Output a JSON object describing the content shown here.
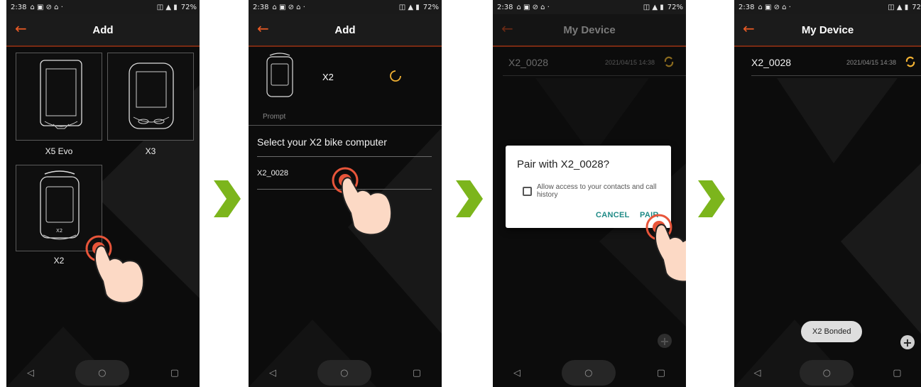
{
  "colors": {
    "accent": "#ea5b25",
    "arrow_green": "#7cb51c",
    "dialog_button": "#1e8a86",
    "spinner": "#f2b233"
  },
  "status_bar": {
    "time": "2:38",
    "battery": "72%",
    "battery_cut": "72"
  },
  "icons": {
    "back": "arrow-left-icon",
    "nav_back": "nav-back-icon",
    "nav_home": "nav-home-icon",
    "nav_recent": "nav-recent-icon",
    "arrow_right": "chevron-right-icon",
    "sync": "sync-icon",
    "add": "plus-icon",
    "hand": "tap-hand-icon",
    "spinner": "loading-spinner-icon"
  },
  "nav_glyphs": {
    "back": "◁",
    "home": "○",
    "recent": "▢"
  },
  "back_glyph": "←",
  "fab_glyph": "+",
  "screen1": {
    "title": "Add",
    "devices": [
      {
        "label": "X5 Evo"
      },
      {
        "label": "X3"
      },
      {
        "label": "X2"
      }
    ]
  },
  "screen2": {
    "title": "Add",
    "device_name": "X2",
    "prompt_label": "Prompt",
    "instruction": "Select your X2 bike computer",
    "list_item": "X2_0028"
  },
  "screen3": {
    "title": "My Device",
    "device_row": {
      "name": "X2_0028",
      "timestamp": "2021/04/15 14:38"
    },
    "dialog": {
      "title": "Pair with X2_0028?",
      "checkbox_label": "Allow access to your contacts and call history",
      "cancel": "CANCEL",
      "pair": "PAIR"
    }
  },
  "screen4": {
    "title": "My Device",
    "device_row": {
      "name": "X2_0028",
      "timestamp": "2021/04/15 14:38"
    },
    "toast": "X2 Bonded"
  }
}
